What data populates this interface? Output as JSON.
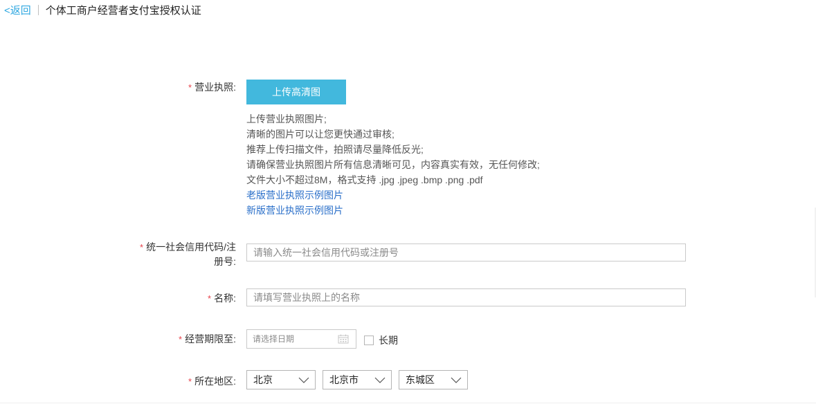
{
  "header": {
    "back_label": "<返回",
    "title": "个体工商户经营者支付宝授权认证"
  },
  "form": {
    "required_mark": "*",
    "license": {
      "label": "营业执照:",
      "upload_button": "上传高清图",
      "tips": [
        "上传营业执照图片;",
        "清晰的图片可以让您更快通过审核;",
        "推荐上传扫描文件，拍照请尽量降低反光;",
        "请确保营业执照图片所有信息清晰可见，内容真实有效，无任何修改;",
        "文件大小不超过8M，格式支持 .jpg .jpeg .bmp .png .pdf"
      ],
      "links": [
        "老版营业执照示例图片",
        "新版营业执照示例图片"
      ]
    },
    "credit_code": {
      "label_line1": "统一社会信用代码/注",
      "label_line2": "册号:",
      "placeholder": "请输入统一社会信用代码或注册号"
    },
    "name": {
      "label": "名称:",
      "placeholder": "请填写营业执照上的名称"
    },
    "period": {
      "label": "经营期限至:",
      "placeholder": "请选择日期",
      "icon": "calendar-icon",
      "long_term_label": "长期"
    },
    "region": {
      "label": "所在地区:",
      "province": "北京",
      "city": "北京市",
      "district": "东城区",
      "icon": "chevron-down-icon"
    }
  },
  "colors": {
    "accent": "#42b8dd",
    "link": "#2a6fc9",
    "back_link": "#2ea7e0",
    "required": "#e8424b"
  }
}
